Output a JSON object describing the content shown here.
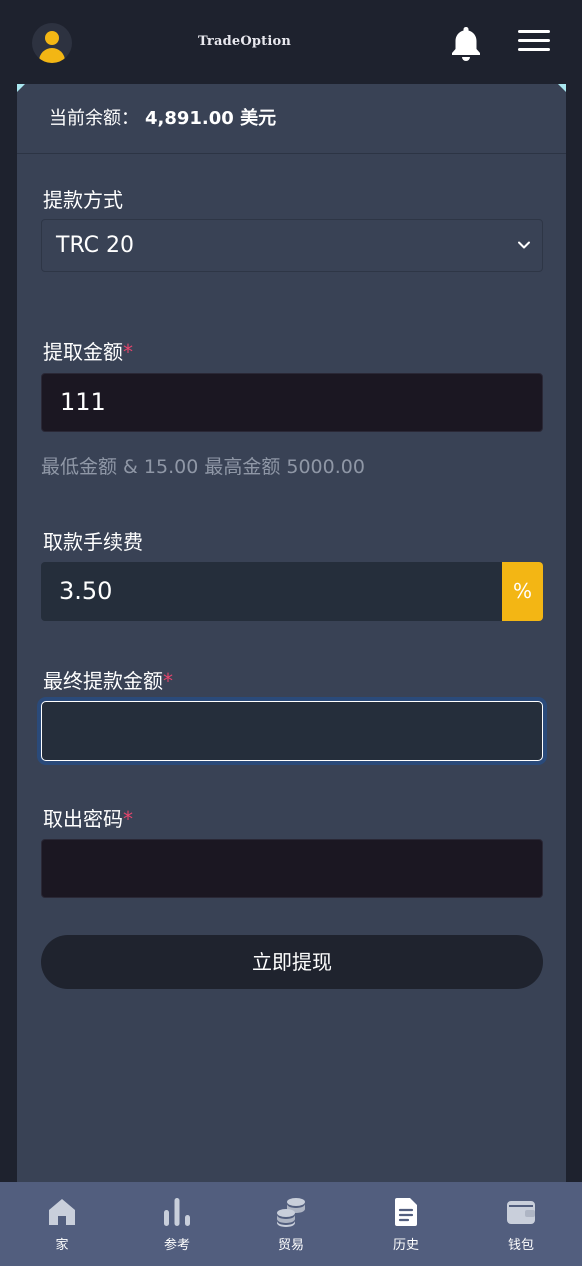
{
  "header": {
    "brand": "TradeOption",
    "avatar_icon": "user-icon",
    "notification_icon": "bell-icon",
    "menu_icon": "hamburger-icon"
  },
  "balance": {
    "label": "当前余额：",
    "amount": "4,891.00 美元"
  },
  "form": {
    "method_label": "提款方式",
    "method_value": "TRC 20",
    "amount_label": "提取金额",
    "amount_value": "111",
    "limits_hint": "最低金额 & 15.00 最高金额 5000.00",
    "fee_label": "取款手续费",
    "fee_value": "3.50",
    "fee_unit": "%",
    "final_label": "最终提款金额",
    "final_value": "",
    "password_label": "取出密码",
    "password_value": "",
    "required_mark": "*",
    "submit_label": "立即提现"
  },
  "bottom_nav": {
    "items": [
      {
        "label": "家",
        "icon": "home-icon"
      },
      {
        "label": "参考",
        "icon": "bar-chart-icon"
      },
      {
        "label": "贸易",
        "icon": "coins-icon"
      },
      {
        "label": "历史",
        "icon": "document-icon"
      },
      {
        "label": "钱包",
        "icon": "wallet-icon"
      }
    ]
  },
  "colors": {
    "background": "#1e222e",
    "card": "#394255",
    "accent": "#f3b614",
    "required": "#e4456c",
    "nav": "#525e7e"
  }
}
